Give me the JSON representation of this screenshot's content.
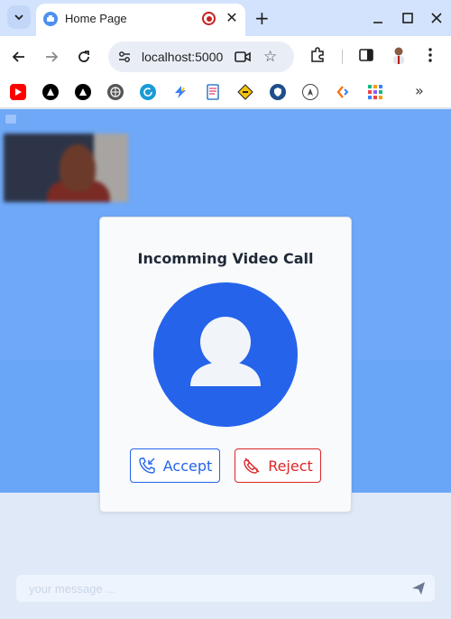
{
  "browser": {
    "tab_title": "Home Page",
    "url": "localhost:5000",
    "new_tab_label": "+",
    "more_bookmarks": "»"
  },
  "bookmarks": [
    {
      "icon": "youtube-icon",
      "color": "#ff0000"
    },
    {
      "icon": "triangle-logo-icon",
      "color": "#000000"
    },
    {
      "icon": "triangle-logo-icon",
      "color": "#000000"
    },
    {
      "icon": "globe-icon",
      "color": "#555555"
    },
    {
      "icon": "refresh-logo-icon",
      "color": "#1a9bd7"
    },
    {
      "icon": "bolt-icon",
      "color": "#3b82f6"
    },
    {
      "icon": "document-icon",
      "color": "#1565c0"
    },
    {
      "icon": "diamond-sign-icon",
      "color": "#f4c20d"
    },
    {
      "icon": "shield-icon",
      "color": "#1e4e8c"
    },
    {
      "icon": "compass-icon",
      "color": "#444444"
    },
    {
      "icon": "code-icon",
      "color": "#f97316"
    },
    {
      "icon": "grid-icon",
      "color": "#10b981"
    }
  ],
  "chat": {
    "placeholder": "your message ..."
  },
  "modal": {
    "title": "Incomming Video Call",
    "accept_label": "Accept",
    "reject_label": "Reject"
  },
  "colors": {
    "accent": "#2563eb",
    "danger": "#dc2626",
    "backdrop": "#6aa6f8"
  }
}
